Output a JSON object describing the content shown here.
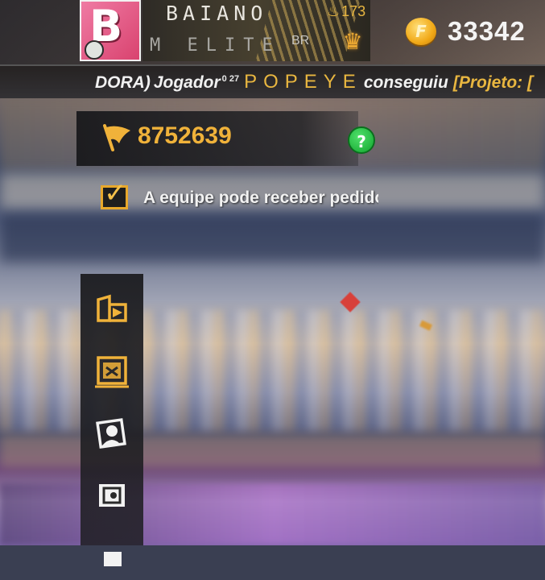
{
  "profile": {
    "nickname": "BAIANO",
    "level": "173",
    "guild_name": "M ELITE",
    "region": "BR"
  },
  "currency": {
    "coin_symbol": "F",
    "amount": "33342"
  },
  "ticker": {
    "prefix": "DORA)",
    "text1": "Jogador",
    "sup": "0 27",
    "player": "POPEYE",
    "text2": "conseguiu",
    "highlight": "[Projeto: ["
  },
  "guild": {
    "points": "8752639",
    "help_label": "?"
  },
  "requests": {
    "checked": true,
    "label": "A equipe pode receber pedidos"
  },
  "colors": {
    "accent_gold": "#f0b23a",
    "help_green": "#12a52e",
    "panel_dark": "#1e1e22"
  },
  "side_menu": {
    "items": [
      "home-icon",
      "storage-icon",
      "members-icon",
      "vault-icon",
      "more-icon"
    ]
  }
}
